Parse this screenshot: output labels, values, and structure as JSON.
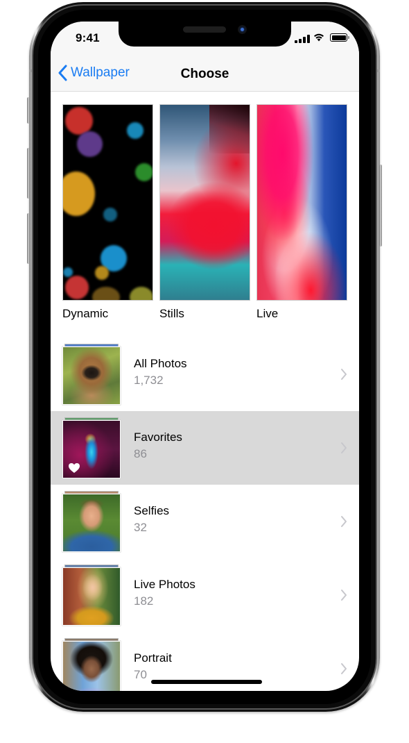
{
  "status_bar": {
    "time": "9:41",
    "icons": [
      "cellular-signal-icon",
      "wifi-icon",
      "battery-icon"
    ]
  },
  "nav": {
    "back_label": "Wallpaper",
    "title": "Choose",
    "accent_color": "#1a7cf2"
  },
  "categories": [
    {
      "label": "Dynamic"
    },
    {
      "label": "Stills"
    },
    {
      "label": "Live"
    }
  ],
  "albums": [
    {
      "name": "All Photos",
      "count": "1,732",
      "selected": false
    },
    {
      "name": "Favorites",
      "count": "86",
      "selected": true
    },
    {
      "name": "Selfies",
      "count": "32",
      "selected": false
    },
    {
      "name": "Live Photos",
      "count": "182",
      "selected": false
    },
    {
      "name": "Portrait",
      "count": "70",
      "selected": false
    }
  ],
  "colors": {
    "selected_row": "#d9d9d9",
    "secondary_text": "#8e8e93",
    "chevron": "#c7c7cc"
  }
}
